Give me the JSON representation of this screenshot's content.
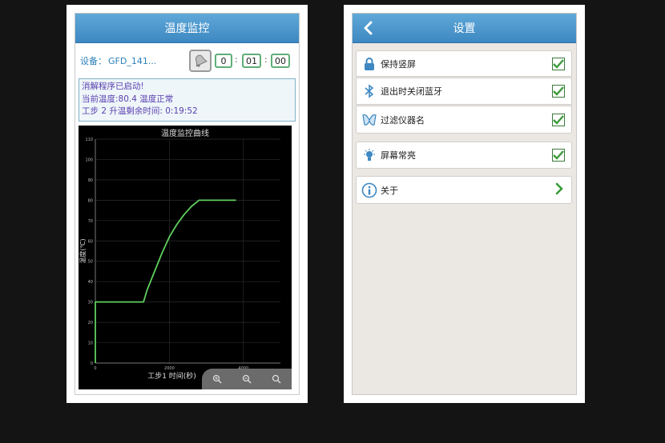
{
  "monitor": {
    "title": "温度监控",
    "device_label": "设备：",
    "device_value": "GFD_141...",
    "time": {
      "h": "0",
      "m": "01",
      "s": "00"
    },
    "time_sep": ":",
    "status_lines": [
      "消解程序已启动!",
      "当前温度:80.4 温度正常",
      "工步 2 升温剩余时间: 0:19:52"
    ]
  },
  "chart_data": {
    "type": "line",
    "title": "温度监控曲线",
    "xlabel": "工步1 时间(秒)",
    "ylabel": "温度(℃)",
    "xlim": [
      0,
      5000
    ],
    "ylim": [
      0,
      110
    ],
    "xticks": [
      0,
      2000,
      4000
    ],
    "yticks": [
      0,
      10,
      20,
      30,
      40,
      50,
      60,
      70,
      80,
      90,
      100,
      110
    ],
    "grid": true,
    "color": "#5fcf5f",
    "x": [
      0,
      0,
      0,
      1300,
      1400,
      1600,
      1800,
      2000,
      2200,
      2400,
      2600,
      2800,
      2900,
      3000,
      3800
    ],
    "y": [
      0,
      30,
      30,
      30,
      36,
      45,
      54,
      62,
      68,
      73,
      77,
      80,
      80,
      80,
      80
    ]
  },
  "zoom_icons": [
    "zoom-in-icon",
    "zoom-out-icon",
    "zoom-reset-icon"
  ],
  "settings": {
    "title": "设置",
    "items": [
      {
        "label": "保持竖屏",
        "icon": "lock-icon",
        "checked": true
      },
      {
        "label": "退出时关闭蓝牙",
        "icon": "bluetooth-icon",
        "checked": true
      },
      {
        "label": "过滤仪器名",
        "icon": "filter-icon",
        "checked": true
      },
      {
        "label": "屏幕常亮",
        "icon": "bulb-icon",
        "checked": true
      },
      {
        "label": "关于",
        "icon": "info-icon",
        "checked": null
      }
    ]
  },
  "colors": {
    "header": "#3d88c2",
    "check": "#3a7a3a",
    "line": "#5fcf5f"
  }
}
